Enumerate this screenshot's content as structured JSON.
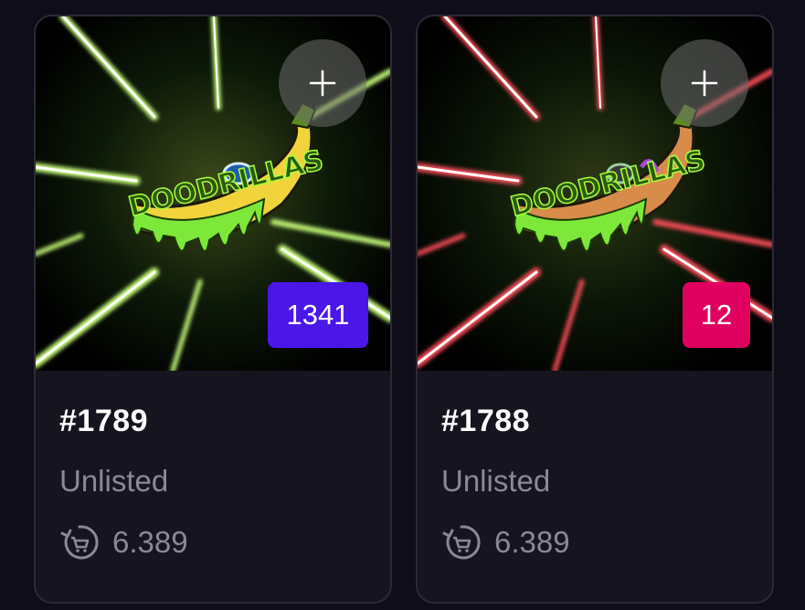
{
  "cards": [
    {
      "name": "#1789",
      "status": "Unlisted",
      "price": "6.389",
      "rank": "1341",
      "rank_color": "#4b16e8",
      "ray_color": "#c9ff7a",
      "banana_color": "#f1d33b",
      "add_icon": "plus-icon",
      "price_icon": "cart-refresh-icon",
      "art_logo": "DOODRILLAS"
    },
    {
      "name": "#1788",
      "status": "Unlisted",
      "price": "6.389",
      "rank": "12",
      "rank_color": "#e0005f",
      "ray_color": "#ff6b6b",
      "banana_color": "#d98b4a",
      "add_icon": "plus-icon",
      "price_icon": "cart-refresh-icon",
      "art_logo": "DOODRILLAS"
    }
  ]
}
